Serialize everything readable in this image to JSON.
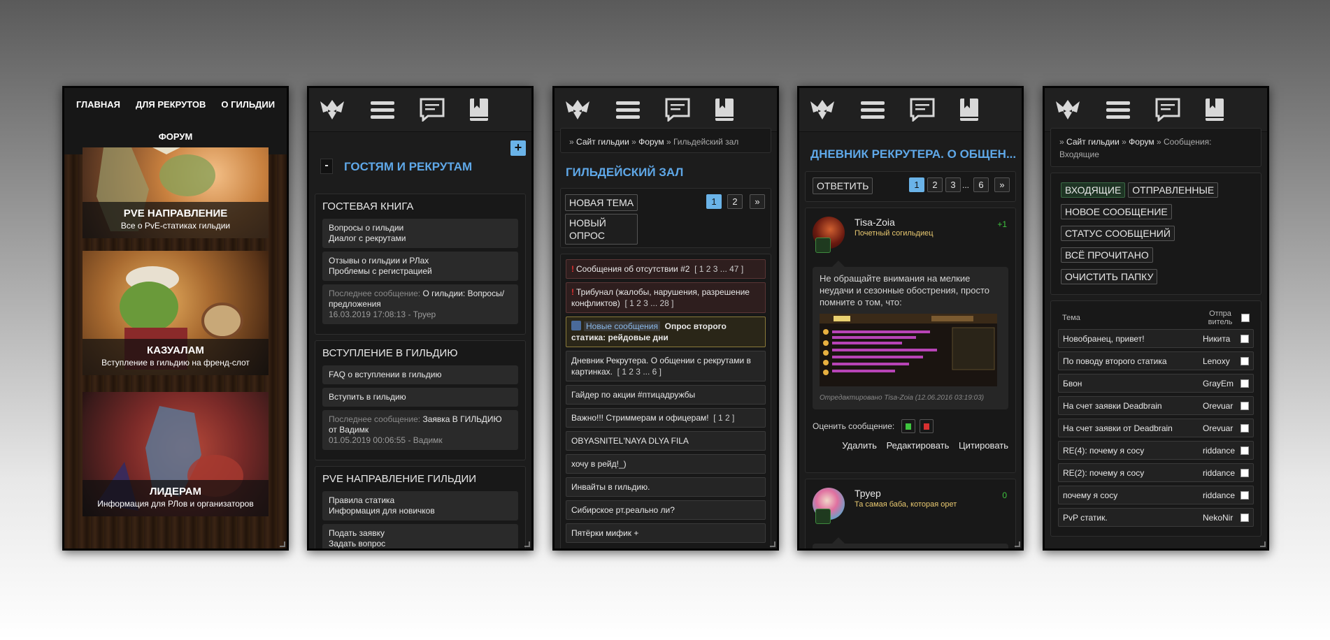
{
  "phone1": {
    "nav": [
      "ГЛАВНАЯ",
      "ДЛЯ РЕКРУТОВ",
      "О ГИЛЬДИИ",
      "ФОРУМ"
    ],
    "cards": [
      {
        "title": "PVE НАПРАВЛЕНИЕ",
        "subtitle": "Все о PvE-статиках гильдии"
      },
      {
        "title": "КАЗУАЛАМ",
        "subtitle": "Вступление в гильдию на френд-слот"
      },
      {
        "title": "ЛИДЕРАМ",
        "subtitle": "Информация для РЛов и организаторов"
      }
    ]
  },
  "phone2": {
    "collapse_label": "-",
    "plus_label": "+",
    "title": "ГОСТЯМ И РЕКРУТАМ",
    "sections": [
      {
        "title": "ГОСТЕВАЯ КНИГА",
        "rows": [
          {
            "line1": "Вопросы о гильдии",
            "line2": "Диалог с рекрутами"
          },
          {
            "line1": "Отзывы о гильдии и РЛах",
            "line2": "Проблемы с регистрацией"
          }
        ],
        "last": {
          "label": "Последнее сообщение:",
          "text": "О гильдии: Вопросы/предложения",
          "time": "16.03.2019 17:08:13 - Труер"
        }
      },
      {
        "title": "ВСТУПЛЕНИЕ В ГИЛЬДИЮ",
        "rows": [
          {
            "line1": "FAQ о вступлении в гильдию",
            "line2": ""
          },
          {
            "line1": "Вступить в гильдию",
            "line2": ""
          }
        ],
        "last": {
          "label": "Последнее сообщение:",
          "text": "Заявка В ГИЛЬДИЮ от Вадимк",
          "time": "01.05.2019 00:06:55 - Вадимк"
        }
      },
      {
        "title": "PVE НАПРАВЛЕНИЕ ГИЛЬДИИ",
        "rows": [
          {
            "line1": "Правила статика",
            "line2": "Информация для новичков"
          },
          {
            "line1": "Подать заявку",
            "line2": "Задать вопрос"
          }
        ]
      }
    ]
  },
  "phone3": {
    "crumb": {
      "sep": "»",
      "site": "Сайт гильдии",
      "forum": "Форум",
      "current": "Гильдейский зал"
    },
    "title": "ГИЛЬДЕЙСКИЙ ЗАЛ",
    "new_topic": "НОВАЯ ТЕМА",
    "new_poll_1": "НОВЫЙ",
    "new_poll_2": "ОПРОС",
    "pages": [
      "1",
      "2",
      "»"
    ],
    "topics": [
      {
        "title": "Сообщения об отсутствии #2",
        "pages": "[ 1 2 3 ... 47 ]"
      },
      {
        "title": "Трибунал (жалобы, нарушения, разрешение конфликтов)",
        "pages": "[ 1 2 3 ... 28 ]"
      },
      {
        "badge": "Новые сообщения",
        "title": "Опрос второго статика: рейдовые дни"
      },
      {
        "title": "Дневник Рекрутера. О общении с рекрутами в картинках.",
        "pages": "[ 1 2 3 ... 6 ]"
      },
      {
        "title": "Гайдер по акции #птицадружбы"
      },
      {
        "title": "Важно!!! Стриммерам и офицерам!",
        "pages": "[ 1 2 ]"
      },
      {
        "title": "OBYASNITEL'NAYA DLYA FILA"
      },
      {
        "title": "хочу в рейд!_)"
      },
      {
        "title": "Инвайты в гильдию."
      },
      {
        "title": "Сибирское рт.реально ли?"
      },
      {
        "title": "Пятёрки мифик +"
      }
    ]
  },
  "phone4": {
    "title": "ДНЕВНИК РЕКРУТЕРА. О ОБЩЕН...",
    "reply": "ОТВЕТИТЬ",
    "pages": [
      "1",
      "2",
      "3",
      "...",
      "6",
      "»"
    ],
    "post1": {
      "name": "Tisa-Zoia",
      "rank": "Почетный согильдиец",
      "rep": "+1",
      "text": "Не обращайте внимания на мелкие неудачи и сезонные обострения, просто помните о том, что:",
      "edited": "Отредактировано Tisa-Zoia (12.06.2016 03:19:03)",
      "rate_label": "Оценить сообщение:",
      "actions": [
        "Удалить",
        "Редактировать",
        "Цитировать"
      ]
    },
    "post2": {
      "name": "Труер",
      "rank": "Та самая баба, которая орет",
      "rep": "0"
    }
  },
  "phone5": {
    "crumb": {
      "sep": "»",
      "site": "Сайт гильдии",
      "forum": "Форум",
      "current": "Сообщения: Входящие"
    },
    "buttons": [
      "ВХОДЯЩИЕ",
      "ОТПРАВЛЕННЫЕ",
      "НОВОЕ СООБЩЕНИЕ",
      "СТАТУС СООБЩЕНИЙ",
      "ВСЁ ПРОЧИТАНО",
      "ОЧИСТИТЬ ПАПКУ"
    ],
    "col_subject": "Тема",
    "col_sender_1": "Отпра",
    "col_sender_2": "витель",
    "messages": [
      {
        "subject": "Новобранец, привет!",
        "from": "Никита"
      },
      {
        "subject": "По поводу второго статика",
        "from": "Lenoxy"
      },
      {
        "subject": "Бвон",
        "from": "GrayEm"
      },
      {
        "subject": "На счет заявки Deadbrain",
        "from": "Orevuar"
      },
      {
        "subject": "На счет заявки от Deadbrain",
        "from": "Orevuar"
      },
      {
        "subject": "RE(4): почему я сосу",
        "from": "riddance"
      },
      {
        "subject": "RE(2): почему я сосу",
        "from": "riddance"
      },
      {
        "subject": "почему я сосу",
        "from": "riddance"
      },
      {
        "subject": "PvP статик.",
        "from": "NekoNir"
      }
    ]
  }
}
